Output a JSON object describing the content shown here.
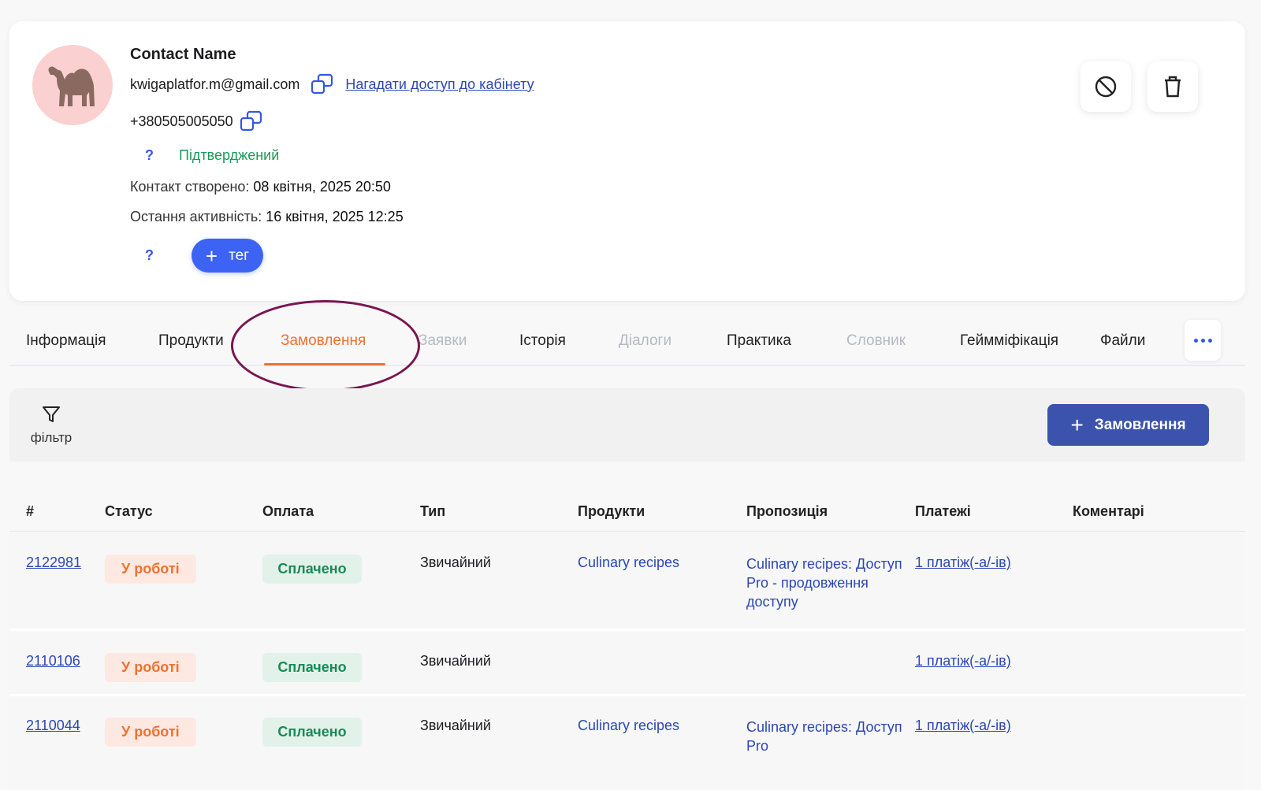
{
  "contact": {
    "name": "Contact Name",
    "email": "kwigaplatfor.m@gmail.com",
    "remind_link": "Нагадати доступ до кабінету",
    "phone": "+380505005050",
    "help_mark": "?",
    "status": "Підтверджений",
    "created_label": "Контакт створено:",
    "created_value": "08 квітня, 2025 20:50",
    "activity_label": "Остання активність:",
    "activity_value": "16 квітня, 2025 12:25",
    "tag_button": "тег",
    "avatar_icon": "camel-icon"
  },
  "tabs": [
    {
      "label": "Інформація"
    },
    {
      "label": "Продукти"
    },
    {
      "label": "Замовлення"
    },
    {
      "label": "Заявки"
    },
    {
      "label": "Історія"
    },
    {
      "label": "Діалоги"
    },
    {
      "label": "Практика"
    },
    {
      "label": "Словник"
    },
    {
      "label": "Геймміфікація"
    },
    {
      "label": "Файли"
    }
  ],
  "toolbar": {
    "filter_label": "фільтр",
    "add_order_label": "Замовлення"
  },
  "table": {
    "headers": [
      "#",
      "Статус",
      "Оплата",
      "Тип",
      "Продукти",
      "Пропозиція",
      "Платежі",
      "Коментарі"
    ],
    "rows": [
      {
        "id": "2122981",
        "status": "У роботі",
        "payment": "Сплачено",
        "type": "Звичайний",
        "product": "Culinary recipes",
        "offer": "Culinary recipes: Доступ Pro - продовження доступу",
        "payments": "1 платіж(-а/-ів)",
        "comments": ""
      },
      {
        "id": "2110106",
        "status": "У роботі",
        "payment": "Сплачено",
        "type": "Звичайний",
        "product": "",
        "offer": "",
        "payments": "1 платіж(-а/-ів)",
        "comments": ""
      },
      {
        "id": "2110044",
        "status": "У роботі",
        "payment": "Сплачено",
        "type": "Звичайний",
        "product": "Culinary recipes",
        "offer": "Culinary recipes: Доступ Pro",
        "payments": "1 платіж(-а/-ів)",
        "comments": ""
      }
    ]
  },
  "colors": {
    "accent_orange": "#f0712f",
    "primary_blue": "#3d63f5",
    "button_navy": "#3c53ad",
    "confirmed_green": "#1a9a5a",
    "highlight_ellipse": "#7a1650"
  }
}
